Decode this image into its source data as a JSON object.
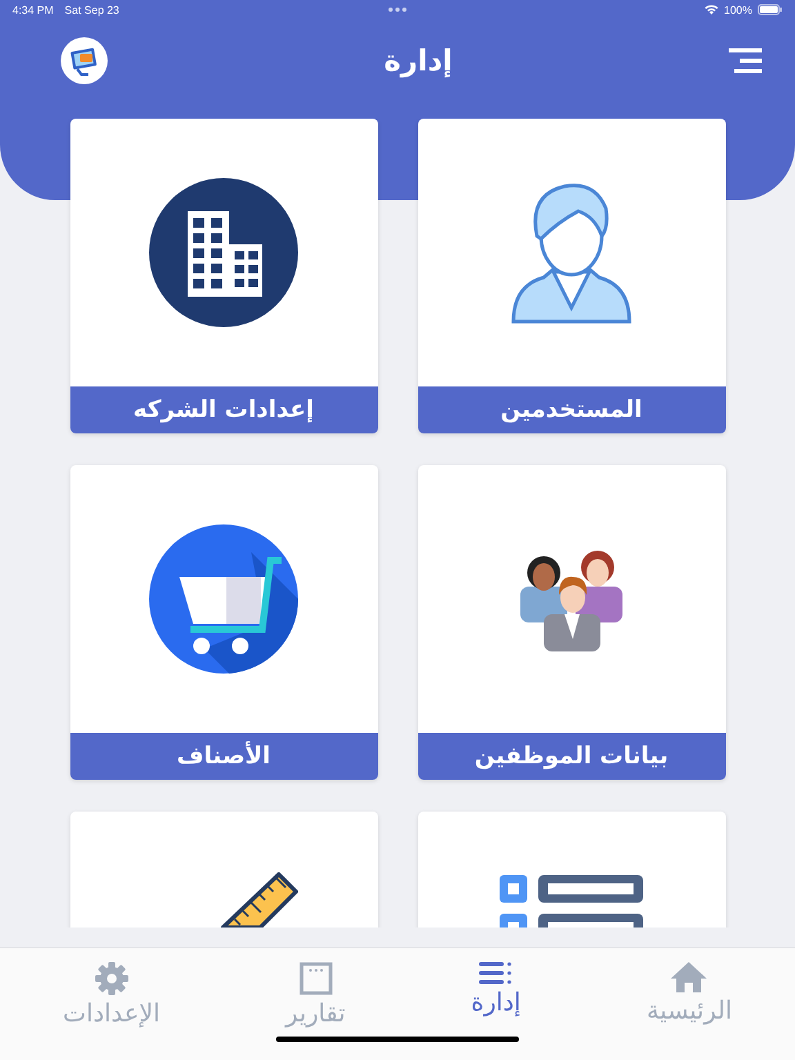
{
  "status_bar": {
    "time": "4:34 PM",
    "date": "Sat Sep 23",
    "battery": "100%"
  },
  "header": {
    "title": "إدارة"
  },
  "cards": [
    {
      "kind": "users",
      "label": "المستخدمين"
    },
    {
      "kind": "company",
      "label": "إعدادات الشركه"
    },
    {
      "kind": "employees",
      "label": "بيانات الموظفين"
    },
    {
      "kind": "cart",
      "label": "الأصناف"
    },
    {
      "kind": "list"
    },
    {
      "kind": "ruler"
    }
  ],
  "tab_bar": [
    {
      "kind": "home",
      "label": "الرئيسية",
      "selected": false
    },
    {
      "kind": "manage",
      "label": "إدارة",
      "selected": true
    },
    {
      "kind": "reports",
      "label": "تقارير",
      "selected": false
    },
    {
      "kind": "settings",
      "label": "الإعدادات",
      "selected": false
    }
  ]
}
